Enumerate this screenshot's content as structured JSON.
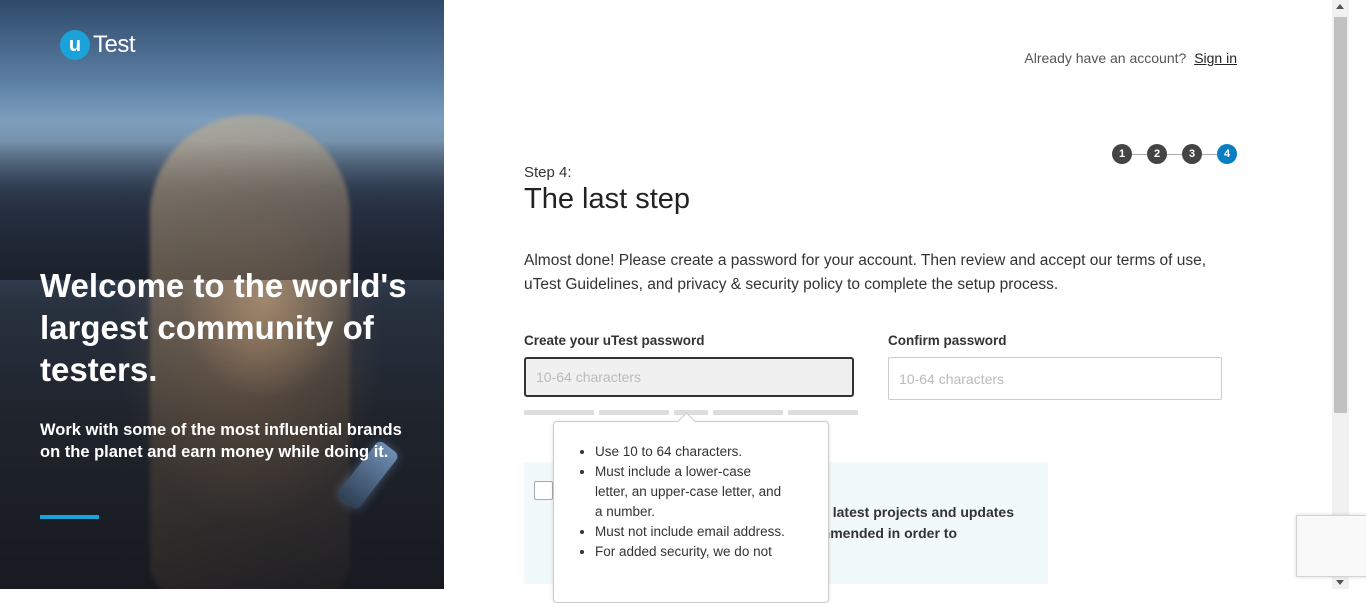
{
  "hero": {
    "logo_letter": "u",
    "logo_word": "Test",
    "headline": "Welcome to the world's largest community of testers.",
    "subtext": "Work with some of the most influential brands on the planet and earn money while doing it."
  },
  "header": {
    "already_text": "Already have an account?",
    "signin_label": "Sign in"
  },
  "steps": {
    "items": [
      "1",
      "2",
      "3",
      "4"
    ],
    "active": "4"
  },
  "main": {
    "step_label": "Step 4:",
    "title": "The last step",
    "intro": "Almost done! Please create a password for your account. Then review and accept our terms of use, uTest Guidelines, and privacy & security policy to complete the setup process."
  },
  "password": {
    "label": "Create your uTest password",
    "placeholder": "10-64 characters",
    "value": ""
  },
  "confirm": {
    "label": "Confirm password",
    "placeholder": "10-64 characters",
    "value": ""
  },
  "tooltip": {
    "rules": [
      "Use 10 to 64 characters.",
      "Must include a lower-case letter, an upper-case letter, and a number.",
      "Must not include email address.",
      "For added security, we do not"
    ]
  },
  "newsletter": {
    "text_line1": "he latest projects and updates",
    "text_line2": "recommended in order to",
    "checked": false
  },
  "colors": {
    "accent": "#1ba2d8",
    "active_step": "#0a7ec2",
    "panel_bg": "#f1f9fb"
  }
}
